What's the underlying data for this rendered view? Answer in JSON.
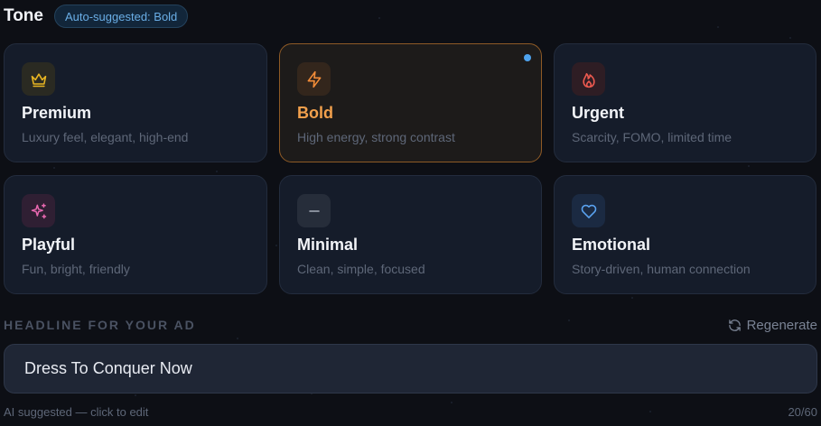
{
  "header": {
    "title": "Tone",
    "badge": "Auto-suggested: Bold"
  },
  "tones": [
    {
      "title": "Premium",
      "description": "Luxury feel, elegant, high-end",
      "icon": "crown-icon",
      "icon_color": "#e6b422",
      "icon_bg": "#2a2a22",
      "selected": false
    },
    {
      "title": "Bold",
      "description": "High energy, strong contrast",
      "icon": "lightning-icon",
      "icon_color": "#f28c38",
      "icon_bg": "#33261c",
      "selected": true
    },
    {
      "title": "Urgent",
      "description": "Scarcity, FOMO, limited time",
      "icon": "flame-icon",
      "icon_color": "#ee5a50",
      "icon_bg": "#2e1d24",
      "selected": false
    },
    {
      "title": "Playful",
      "description": "Fun, bright, friendly",
      "icon": "sparkles-icon",
      "icon_color": "#e868b0",
      "icon_bg": "#2f1f33",
      "selected": false
    },
    {
      "title": "Minimal",
      "description": "Clean, simple, focused",
      "icon": "minus-icon",
      "icon_color": "#a6adba",
      "icon_bg": "#262d3a",
      "selected": false
    },
    {
      "title": "Emotional",
      "description": "Story-driven, human connection",
      "icon": "heart-icon",
      "icon_color": "#5aa2f0",
      "icon_bg": "#1b2a42",
      "selected": false
    }
  ],
  "headline": {
    "label": "HEADLINE FOR YOUR AD",
    "regenerate_label": "Regenerate",
    "value": "Dress To Conquer Now",
    "hint": "AI suggested — click to edit",
    "char_count": "20/60"
  }
}
